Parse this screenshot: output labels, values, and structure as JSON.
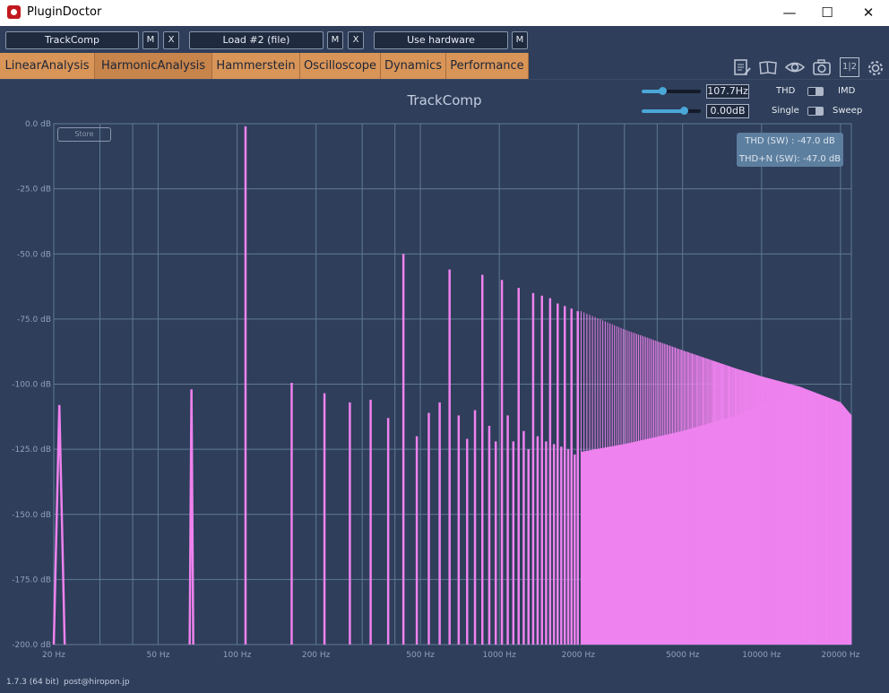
{
  "window": {
    "title": "PluginDoctor",
    "minimize_glyph": "—",
    "maximize_glyph": "☐",
    "close_glyph": "✕"
  },
  "slots": {
    "slot1": {
      "label": "TrackComp",
      "m": "M",
      "x": "X"
    },
    "slot2": {
      "label": "Load #2 (file)",
      "m": "M",
      "x": "X"
    },
    "slot3": {
      "label": "Use hardware",
      "m": "M"
    }
  },
  "tabs": [
    "LinearAnalysis",
    "HarmonicAnalysis",
    "Hammerstein",
    "Oscilloscope",
    "Dynamics",
    "Performance"
  ],
  "active_tab": "HarmonicAnalysis",
  "icons": {
    "notes": "notes-icon",
    "book": "book-icon",
    "eye": "eye-icon",
    "camera": "camera-icon",
    "split": "split-view-icon",
    "split_text": "1|2",
    "settings": "gear-icon"
  },
  "controls": {
    "freq_value": "107.7Hz",
    "freq_level": 0.35,
    "gain_value": "0.00dB",
    "gain_level": 0.72,
    "thd_label": "THD",
    "imd_label": "IMD",
    "single_label": "Single",
    "sweep_label": "Sweep"
  },
  "plot": {
    "title": "TrackComp",
    "store_label": "Store",
    "thd_readout": "THD (SW) : -47.0 dB",
    "thdn_readout": "THD+N (SW): -47.0 dB"
  },
  "footer": {
    "version": "1.7.3 (64 bit)",
    "email": "post@hiropon.jp"
  },
  "colors": {
    "background": "#2f3e5a",
    "grid": "#5f7a94",
    "spectrum": "#ee82ee",
    "tab": "#d99558"
  },
  "chart_data": {
    "type": "bar",
    "xscale": "log",
    "xlim": [
      20,
      22000
    ],
    "ylim": [
      -200,
      0
    ],
    "x_ticks": [
      {
        "v": 20,
        "label": "20 Hz"
      },
      {
        "v": 50,
        "label": "50 Hz"
      },
      {
        "v": 100,
        "label": "100 Hz"
      },
      {
        "v": 200,
        "label": "200 Hz"
      },
      {
        "v": 500,
        "label": "500 Hz"
      },
      {
        "v": 1000,
        "label": "1000 Hz"
      },
      {
        "v": 2000,
        "label": "2000 Hz"
      },
      {
        "v": 5000,
        "label": "5000 Hz"
      },
      {
        "v": 10000,
        "label": "10000 Hz"
      },
      {
        "v": 20000,
        "label": "20000 Hz"
      }
    ],
    "x_grid": [
      20,
      30,
      40,
      50,
      100,
      200,
      300,
      400,
      500,
      1000,
      2000,
      3000,
      4000,
      5000,
      10000,
      20000
    ],
    "y_ticks": [
      {
        "v": 0,
        "label": "0.0 dB"
      },
      {
        "v": -25,
        "label": "-25.0 dB"
      },
      {
        "v": -50,
        "label": "-50.0 dB"
      },
      {
        "v": -75,
        "label": "-75.0 dB"
      },
      {
        "v": -100,
        "label": "-100.0 dB"
      },
      {
        "v": -125,
        "label": "-125.0 dB"
      },
      {
        "v": -150,
        "label": "-150.0 dB"
      },
      {
        "v": -175,
        "label": "-175.0 dB"
      },
      {
        "v": -200,
        "label": "-200.0 dB"
      }
    ],
    "peaks": [
      {
        "f": 21,
        "db": -108
      },
      {
        "f": 67,
        "db": -102
      },
      {
        "f": 107.7,
        "db": -1
      },
      {
        "f": 161.5,
        "db": -99.5
      },
      {
        "f": 215.4,
        "db": -103.5
      },
      {
        "f": 269.2,
        "db": -107
      },
      {
        "f": 323.1,
        "db": -106
      },
      {
        "f": 376.9,
        "db": -113
      },
      {
        "f": 430.8,
        "db": -50
      },
      {
        "f": 484.6,
        "db": -120
      },
      {
        "f": 538.5,
        "db": -111
      },
      {
        "f": 592.3,
        "db": -107
      },
      {
        "f": 646.2,
        "db": -56
      },
      {
        "f": 700,
        "db": -112
      },
      {
        "f": 753.9,
        "db": -121
      },
      {
        "f": 807.7,
        "db": -110
      },
      {
        "f": 861.6,
        "db": -58
      },
      {
        "f": 915.4,
        "db": -116
      },
      {
        "f": 969.3,
        "db": -122
      },
      {
        "f": 1023,
        "db": -60
      },
      {
        "f": 1077,
        "db": -112
      },
      {
        "f": 1131,
        "db": -122
      },
      {
        "f": 1185,
        "db": -63
      },
      {
        "f": 1239,
        "db": -118
      },
      {
        "f": 1292,
        "db": -125
      },
      {
        "f": 1346,
        "db": -65
      },
      {
        "f": 1400,
        "db": -120
      },
      {
        "f": 1454,
        "db": -66
      },
      {
        "f": 1508,
        "db": -122
      },
      {
        "f": 1562,
        "db": -67
      },
      {
        "f": 1616,
        "db": -123
      },
      {
        "f": 1669,
        "db": -69
      },
      {
        "f": 1723,
        "db": -124
      },
      {
        "f": 1777,
        "db": -70
      },
      {
        "f": 1831,
        "db": -125
      },
      {
        "f": 1885,
        "db": -71
      },
      {
        "f": 1939,
        "db": -127
      },
      {
        "f": 1992,
        "db": -72
      }
    ],
    "dense_start_hz": 2050,
    "harmonic_spacing_hz": 53.85,
    "dense_top_db": [
      [
        2050,
        -72
      ],
      [
        3000,
        -79
      ],
      [
        5000,
        -87
      ],
      [
        8000,
        -94
      ],
      [
        10000,
        -97
      ],
      [
        14000,
        -101
      ],
      [
        20000,
        -107
      ],
      [
        22000,
        -112
      ]
    ],
    "dense_bottom_db": [
      [
        2050,
        -126
      ],
      [
        3000,
        -123
      ],
      [
        5000,
        -118
      ],
      [
        8000,
        -112
      ],
      [
        10000,
        -108
      ],
      [
        14000,
        -104
      ],
      [
        20000,
        -107
      ],
      [
        22000,
        -112
      ]
    ]
  }
}
